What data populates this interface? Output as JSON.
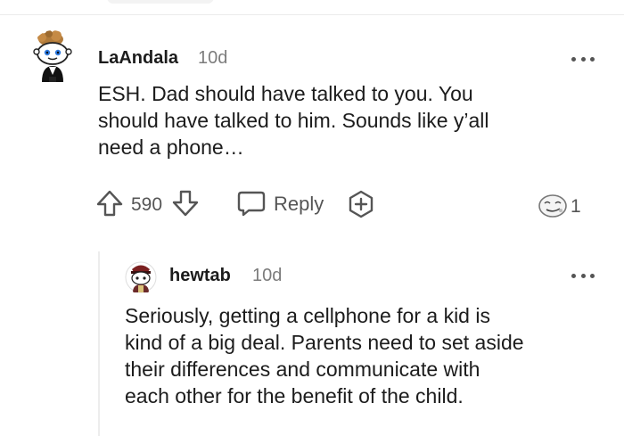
{
  "comments": [
    {
      "username": "LaAndala",
      "time": "10d",
      "text_lines": [
        "ESH. Dad should have talked to you. You",
        "should have talked to him. Sounds like y’all",
        "need a phone…"
      ],
      "votes": "590",
      "reply_label": "Reply",
      "award_count": "1",
      "icons": {
        "avatar": "snoo-avatar-icon",
        "upvote": "upvote-arrow-icon",
        "downvote": "downvote-arrow-icon",
        "reply": "speech-bubble-icon",
        "award": "plus-circle-icon",
        "award_badge": "award-face-icon",
        "more": "more-dots-icon"
      }
    },
    {
      "username": "hewtab",
      "time": "10d",
      "text_lines": [
        "Seriously, getting a cellphone for a kid is",
        "kind of a big deal. Parents need to set aside",
        "their differences and communicate with",
        "each other for the benefit of the child."
      ],
      "icons": {
        "avatar": "snoo-avatar-icon",
        "more": "more-dots-icon"
      }
    }
  ],
  "colors": {
    "text": "#1c1c1c",
    "meta": "#7c7c7c",
    "icon": "#555555",
    "thread_line": "#ededed"
  }
}
